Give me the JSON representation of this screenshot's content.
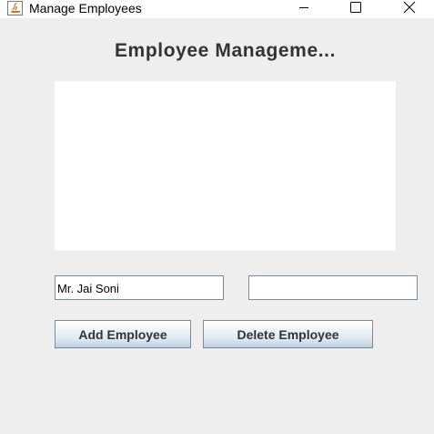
{
  "window": {
    "title": "Manage Employees",
    "controls": {
      "minimize_icon": "minimize-icon",
      "maximize_icon": "maximize-icon",
      "close_icon": "close-icon"
    }
  },
  "main": {
    "heading": "Employee Manageme...",
    "employee_list": [],
    "name_field": {
      "value": "Mr. Jai Soni"
    },
    "second_field": {
      "value": ""
    },
    "buttons": {
      "add_label": "Add Employee",
      "delete_label": "Delete Employee"
    }
  },
  "colors": {
    "background": "#eeeeee",
    "titlebar": "#ffffff",
    "button_gradient_bottom": "#b8cfe5",
    "border": "#7a8a99"
  }
}
